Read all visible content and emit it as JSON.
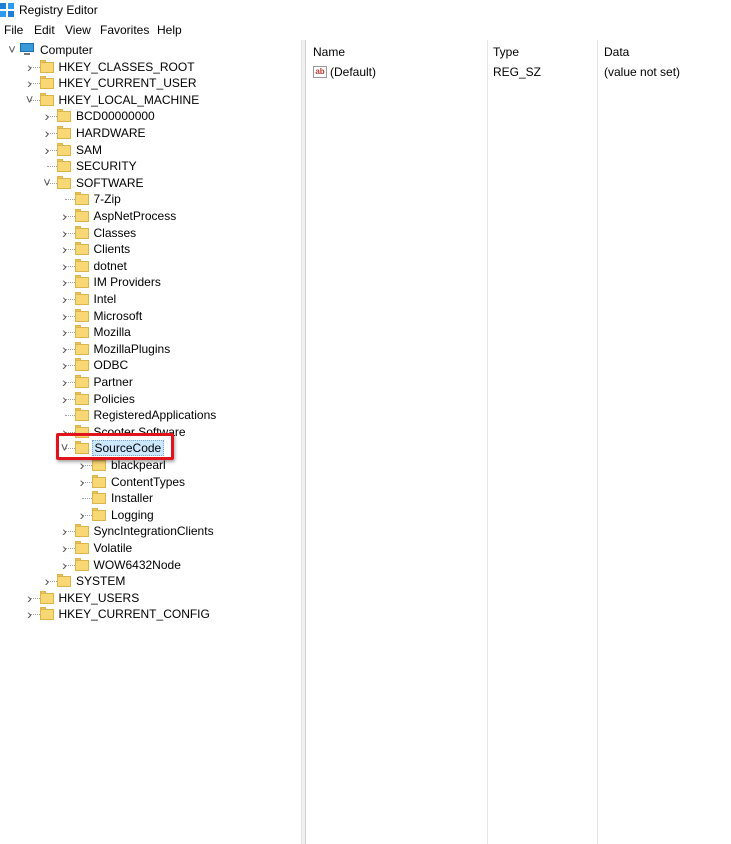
{
  "window": {
    "title": "Registry Editor"
  },
  "menu": [
    "File",
    "Edit",
    "View",
    "Favorites",
    "Help"
  ],
  "tree": [
    {
      "label": "Computer",
      "depth": 0,
      "expander": "expanded",
      "icon": "computer-icon"
    },
    {
      "label": "HKEY_CLASSES_ROOT",
      "depth": 1,
      "expander": "collapsed"
    },
    {
      "label": "HKEY_CURRENT_USER",
      "depth": 1,
      "expander": "collapsed"
    },
    {
      "label": "HKEY_LOCAL_MACHINE",
      "depth": 1,
      "expander": "expanded"
    },
    {
      "label": "BCD00000000",
      "depth": 2,
      "expander": "collapsed"
    },
    {
      "label": "HARDWARE",
      "depth": 2,
      "expander": "collapsed"
    },
    {
      "label": "SAM",
      "depth": 2,
      "expander": "collapsed"
    },
    {
      "label": "SECURITY",
      "depth": 2,
      "expander": "none"
    },
    {
      "label": "SOFTWARE",
      "depth": 2,
      "expander": "expanded"
    },
    {
      "label": "7-Zip",
      "depth": 3,
      "expander": "none"
    },
    {
      "label": "AspNetProcess",
      "depth": 3,
      "expander": "collapsed"
    },
    {
      "label": "Classes",
      "depth": 3,
      "expander": "collapsed"
    },
    {
      "label": "Clients",
      "depth": 3,
      "expander": "collapsed"
    },
    {
      "label": "dotnet",
      "depth": 3,
      "expander": "collapsed"
    },
    {
      "label": "IM Providers",
      "depth": 3,
      "expander": "collapsed"
    },
    {
      "label": "Intel",
      "depth": 3,
      "expander": "collapsed"
    },
    {
      "label": "Microsoft",
      "depth": 3,
      "expander": "collapsed"
    },
    {
      "label": "Mozilla",
      "depth": 3,
      "expander": "collapsed"
    },
    {
      "label": "MozillaPlugins",
      "depth": 3,
      "expander": "collapsed"
    },
    {
      "label": "ODBC",
      "depth": 3,
      "expander": "collapsed"
    },
    {
      "label": "Partner",
      "depth": 3,
      "expander": "collapsed"
    },
    {
      "label": "Policies",
      "depth": 3,
      "expander": "collapsed"
    },
    {
      "label": "RegisteredApplications",
      "depth": 3,
      "expander": "none"
    },
    {
      "label": "Scooter Software",
      "depth": 3,
      "expander": "collapsed"
    },
    {
      "label": "SourceCode",
      "depth": 3,
      "expander": "expanded",
      "selected": true
    },
    {
      "label": "blackpearl",
      "depth": 4,
      "expander": "collapsed"
    },
    {
      "label": "ContentTypes",
      "depth": 4,
      "expander": "collapsed"
    },
    {
      "label": "Installer",
      "depth": 4,
      "expander": "none"
    },
    {
      "label": "Logging",
      "depth": 4,
      "expander": "collapsed"
    },
    {
      "label": "SyncIntegrationClients",
      "depth": 3,
      "expander": "collapsed"
    },
    {
      "label": "Volatile",
      "depth": 3,
      "expander": "collapsed"
    },
    {
      "label": "WOW6432Node",
      "depth": 3,
      "expander": "collapsed"
    },
    {
      "label": "SYSTEM",
      "depth": 2,
      "expander": "collapsed"
    },
    {
      "label": "HKEY_USERS",
      "depth": 1,
      "expander": "collapsed"
    },
    {
      "label": "HKEY_CURRENT_CONFIG",
      "depth": 1,
      "expander": "collapsed"
    }
  ],
  "list": {
    "columns": [
      "Name",
      "Type",
      "Data"
    ],
    "rows": [
      {
        "name": "(Default)",
        "type": "REG_SZ",
        "data": "(value not set)",
        "icon": "string-value-icon"
      }
    ]
  },
  "colors": {
    "highlight_box": "#e0141a",
    "selection": "#cce8ff",
    "folder": "#f8d775"
  }
}
